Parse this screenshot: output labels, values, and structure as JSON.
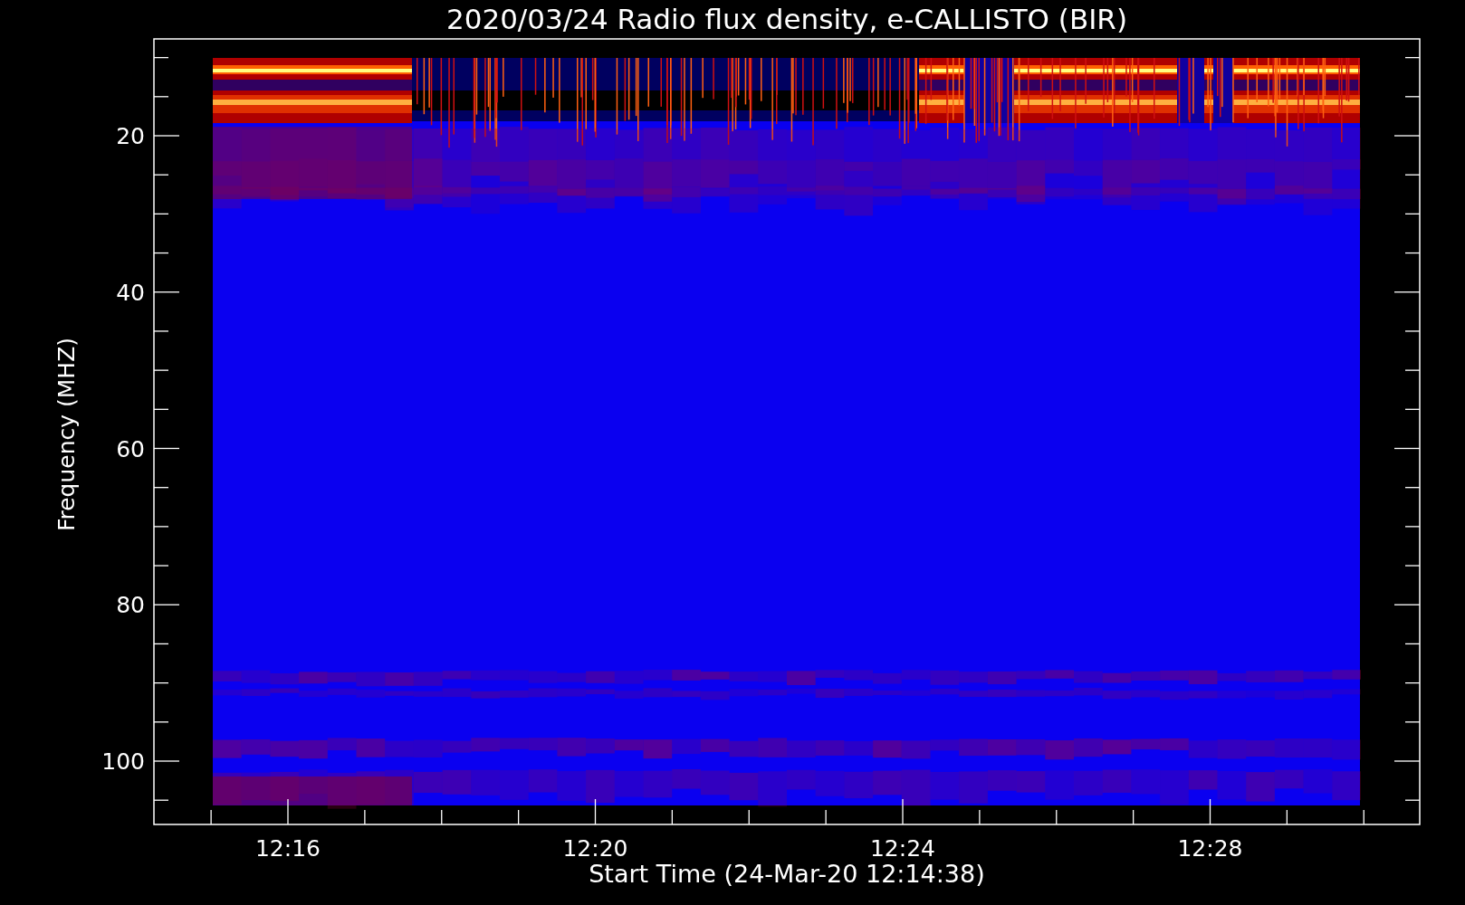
{
  "title": "2020/03/24  Radio flux density, e-CALLISTO (BIR)",
  "ylabel": "Frequency (MHZ)",
  "xlabel": "Start Time (24-Mar-20 12:14:38)",
  "yticks": [
    "20",
    "40",
    "60",
    "80",
    "100"
  ],
  "xticks": [
    "12:16",
    "12:20",
    "12:24",
    "12:28"
  ]
}
